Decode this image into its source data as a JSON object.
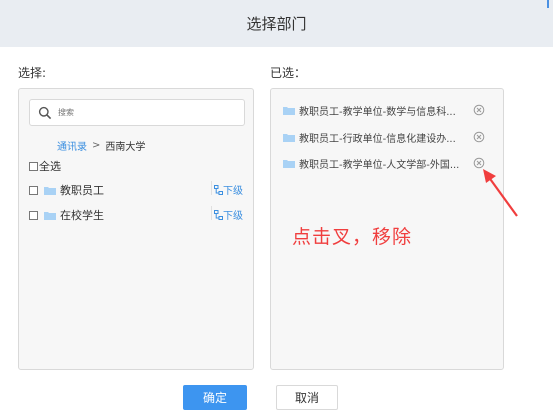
{
  "dialog": {
    "title": "选择部门"
  },
  "labels": {
    "choose": "选择:",
    "selected": "已选："
  },
  "search": {
    "placeholder": "搜索"
  },
  "breadcrumb": {
    "root": "通讯录",
    "separator": ">",
    "current": "西南大学"
  },
  "select_all": "全选",
  "departments": [
    {
      "name": "教职员工",
      "sub_label": "下级"
    },
    {
      "name": "在校学生",
      "sub_label": "下级"
    }
  ],
  "selected_items": [
    {
      "text": "教职员工-教学单位-数学与信息科..."
    },
    {
      "text": "教职员工-行政单位-信息化建设办..."
    },
    {
      "text": "教职员工-教学单位-人文学部-外国..."
    }
  ],
  "annotation": {
    "text": "点击叉，移除"
  },
  "buttons": {
    "ok": "确定",
    "cancel": "取消"
  },
  "colors": {
    "accent": "#3d95f0",
    "link": "#3b8fe0",
    "annotation": "#f03e3e",
    "folder": "#a9d2f5"
  }
}
